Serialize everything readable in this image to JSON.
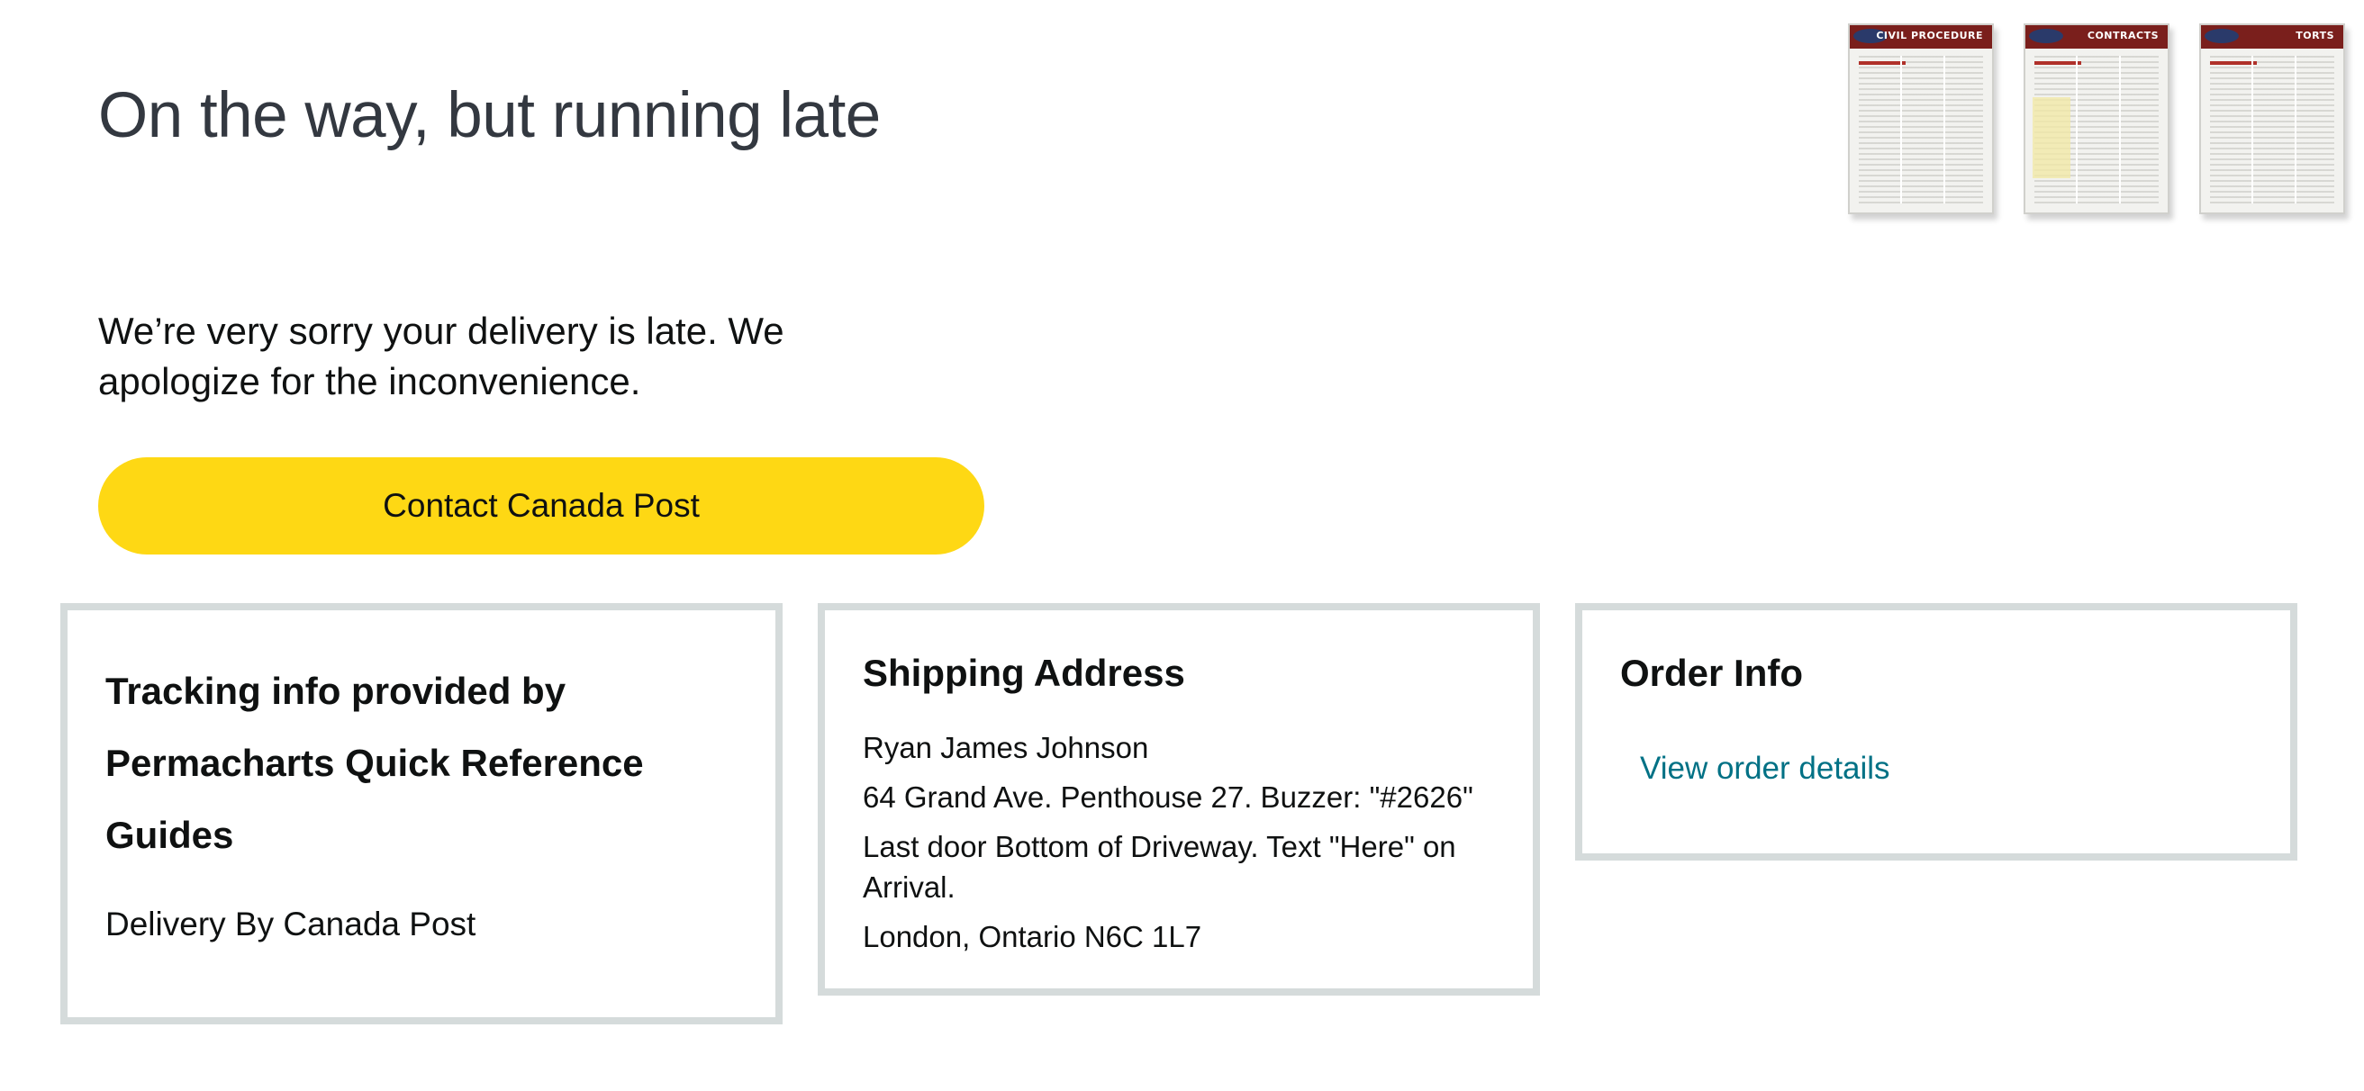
{
  "header": {
    "title": "On the way, but running late"
  },
  "product_images": [
    {
      "name": "Civil Procedure",
      "label": "CIVIL PROCEDURE"
    },
    {
      "name": "Contracts",
      "label": "CONTRACTS"
    },
    {
      "name": "Torts",
      "label": "TORTS"
    }
  ],
  "apology": {
    "text": "We’re very sorry your delivery is late. We apologize for the inconvenience."
  },
  "actions": {
    "contact_label": "Contact Canada Post"
  },
  "tracking": {
    "title": "Tracking info provided by Permacharts Quick Reference Guides",
    "carrier": "Delivery By Canada Post"
  },
  "shipping": {
    "title": "Shipping Address",
    "lines": [
      "Ryan James Johnson",
      "64 Grand Ave. Penthouse 27. Buzzer: \"#2626\"",
      "Last door Bottom of Driveway. Text \"Here\" on Arrival.",
      "London, Ontario N6C 1L7"
    ]
  },
  "order": {
    "title": "Order Info",
    "link_label": "View order details"
  },
  "colors": {
    "button_yellow": "#fed814",
    "link_teal": "#007185",
    "card_border": "#d5dbdb"
  }
}
